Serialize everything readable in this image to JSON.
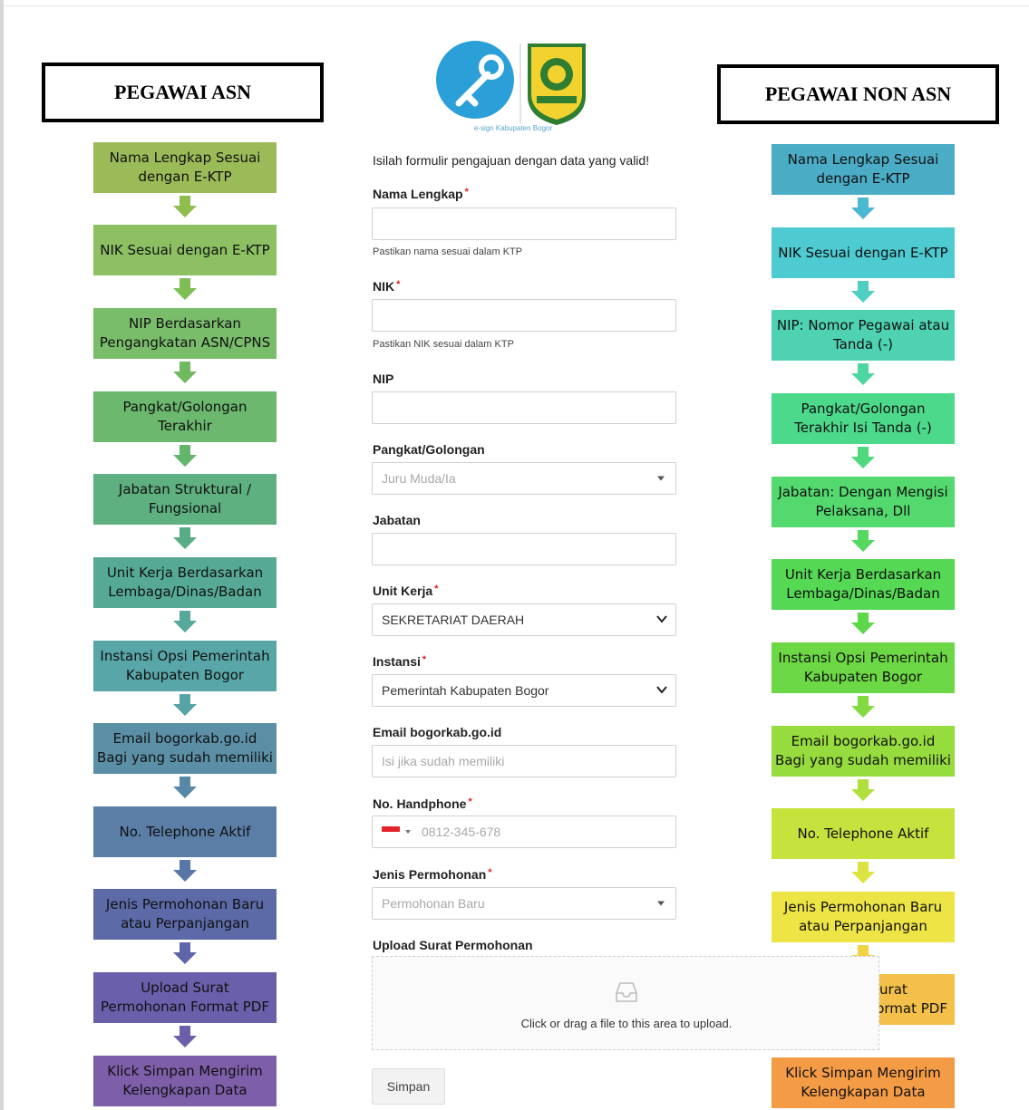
{
  "titles": {
    "asn": "PEGAWAI ASN",
    "non_asn": "PEGAWAI NON ASN"
  },
  "logo": {
    "caption": "e-sign Kabupaten Bogor"
  },
  "left_steps": [
    {
      "label": "Nama Lengkap Sesuai dengan E-KTP",
      "color": "#9bbb59"
    },
    {
      "label": "NIK Sesuai dengan E-KTP",
      "color": "#8cc063"
    },
    {
      "label": "NIP Berdasarkan Pengangkatan ASN/CPNS",
      "color": "#79bd6b"
    },
    {
      "label": "Pangkat/Golongan Terakhir",
      "color": "#6bb86e"
    },
    {
      "label": "Jabatan Struktural / Fungsional",
      "color": "#5fb081"
    },
    {
      "label": "Unit Kerja Berdasarkan Lembaga/Dinas/Badan",
      "color": "#56aa95"
    },
    {
      "label": "Instansi Opsi Pemerintah Kabupaten Bogor",
      "color": "#58a6a8"
    },
    {
      "label": "Email bogorkab.go.id Bagi yang sudah memiliki",
      "color": "#5b8fa6"
    },
    {
      "label": "No. Telephone Aktif",
      "color": "#5a7ea6"
    },
    {
      "label": "Jenis Permohonan Baru atau Perpanjangan",
      "color": "#5c6aa8"
    },
    {
      "label": "Upload Surat Permohonan Format PDF",
      "color": "#6a5faa"
    },
    {
      "label": "Klick Simpan Mengirim Kelengkapan Data",
      "color": "#7d5ea8"
    }
  ],
  "left_arrow_colors": [
    "#8fbd4e",
    "#7fbd55",
    "#6fb95e",
    "#63b56c",
    "#58ad84",
    "#55a89a",
    "#57a3a8",
    "#5888a8",
    "#5876a8",
    "#5e64a8",
    "#6d5ea9"
  ],
  "right_steps": [
    {
      "label": "Nama Lengkap Sesuai dengan E-KTP",
      "color": "#4bacc6"
    },
    {
      "label": "NIK Sesuai dengan E-KTP",
      "color": "#4ecad1"
    },
    {
      "label": "NIP: Nomor Pegawai atau Tanda (-)",
      "color": "#4ed2b1"
    },
    {
      "label": "Pangkat/Golongan Terakhir Isi Tanda (-)",
      "color": "#4dd98b"
    },
    {
      "label": "Jabatan: Dengan Mengisi Pelaksana, Dll",
      "color": "#53d96e"
    },
    {
      "label": "Unit Kerja Berdasarkan Lembaga/Dinas/Badan",
      "color": "#55d853"
    },
    {
      "label": "Instansi Opsi Pemerintah Kabupaten Bogor",
      "color": "#6dd845"
    },
    {
      "label": "Email bogorkab.go.id Bagi yang sudah memiliki",
      "color": "#97dc3e"
    },
    {
      "label": "No. Telephone Aktif",
      "color": "#c6e23d"
    },
    {
      "label": "Jenis Permohonan Baru atau Perpanjangan",
      "color": "#ede446"
    },
    {
      "label": "Upload Surat Permohonan Format PDF",
      "color": "#f4c04a"
    },
    {
      "label": "Klick Simpan Mengirim Kelengkapan Data",
      "color": "#f49b45"
    }
  ],
  "right_arrow_colors": [
    "#4ab8d0",
    "#4ecfc2",
    "#4ed6a0",
    "#50d97c",
    "#54d860",
    "#5dd84b",
    "#82da40",
    "#b1df3d",
    "#dce240",
    "#f2d245",
    "#f4ad47"
  ],
  "form": {
    "intro": "Isilah formulir pengajuan dengan data yang valid!",
    "nama_label": "Nama Lengkap",
    "nama_hint": "Pastikan nama sesuai dalam KTP",
    "nik_label": "NIK",
    "nik_hint": "Pastikan NIK sesuai dalam KTP",
    "nip_label": "NIP",
    "pangkat_label": "Pangkat/Golongan",
    "pangkat_value": "Juru Muda/Ia",
    "jabatan_label": "Jabatan",
    "unit_label": "Unit Kerja",
    "unit_value": "SEKRETARIAT DAERAH",
    "instansi_label": "Instansi",
    "instansi_value": "Pemerintah Kabupaten Bogor",
    "email_label": "Email bogorkab.go.id",
    "email_placeholder": "Isi jika sudah memiliki",
    "phone_label": "No. Handphone",
    "phone_placeholder": "0812-345-678",
    "jenis_label": "Jenis Permohonan",
    "jenis_value": "Permohonan Baru",
    "upload_label": "Upload Surat Permohonan",
    "upload_text": "Click or drag a file to this area to upload.",
    "required_mark": "*",
    "save_label": "Simpan"
  }
}
